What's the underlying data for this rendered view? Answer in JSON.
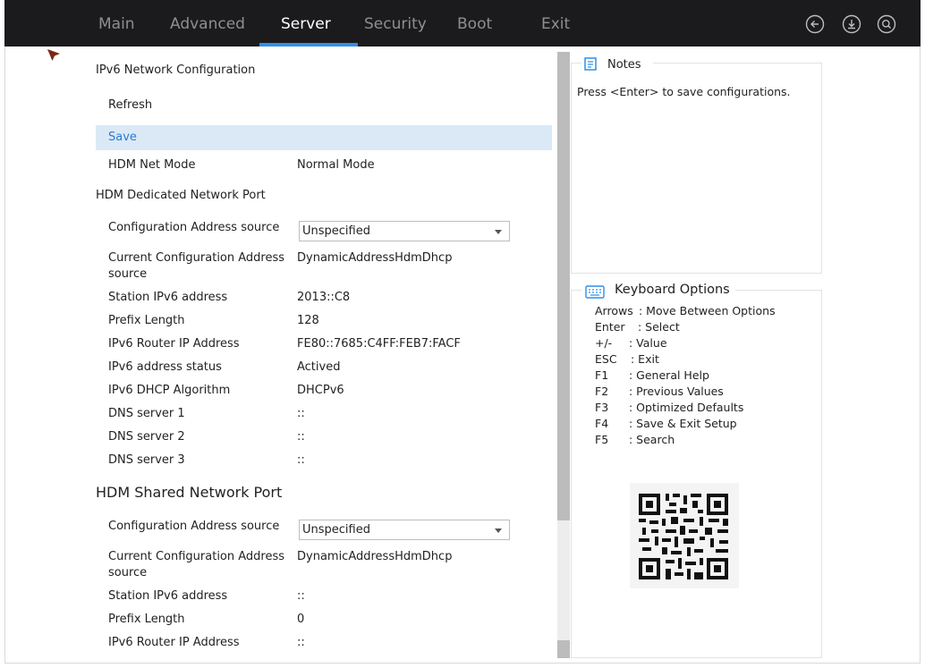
{
  "nav": {
    "tabs": [
      "Main",
      "Advanced",
      "Server",
      "Security",
      "Boot",
      "Exit"
    ],
    "active_tab": "Server",
    "buttons": [
      "back-icon",
      "download-icon",
      "search-icon"
    ]
  },
  "colors": {
    "nav_bg": "#1b1b1e",
    "accent": "#2f8ee8",
    "highlight": "#dbe9f6"
  },
  "ipv6": {
    "title": "IPv6 Network Configuration",
    "refresh": "Refresh",
    "save": "Save",
    "net_mode_label": "HDM Net Mode",
    "net_mode_value": "Normal Mode"
  },
  "dedicated": {
    "title": "HDM Dedicated Network Port",
    "rows": [
      {
        "label": "Configuration Address source",
        "value": "Unspecified"
      },
      {
        "label": "Current Configuration Address source",
        "value": "DynamicAddressHdmDhcp"
      },
      {
        "label": "Station IPv6 address",
        "value": "2013::C8"
      },
      {
        "label": "Prefix Length",
        "value": "128"
      },
      {
        "label": "IPv6 Router IP Address",
        "value": "FE80::7685:C4FF:FEB7:FACF"
      },
      {
        "label": "IPv6 address status",
        "value": "Actived"
      },
      {
        "label": "IPv6 DHCP Algorithm",
        "value": "DHCPv6"
      },
      {
        "label": "DNS server 1",
        "value": "::"
      },
      {
        "label": "DNS server 2",
        "value": "::"
      },
      {
        "label": "DNS server 3",
        "value": "::"
      }
    ]
  },
  "shared": {
    "title": "HDM Shared Network Port",
    "rows": [
      {
        "label": "Configuration Address source",
        "value": "Unspecified"
      },
      {
        "label": "Current Configuration Address source",
        "value": "DynamicAddressHdmDhcp"
      },
      {
        "label": "Station IPv6 address",
        "value": "::"
      },
      {
        "label": "Prefix Length",
        "value": "0"
      },
      {
        "label": "IPv6 Router IP Address",
        "value": "::"
      }
    ]
  },
  "notes": {
    "title": "Notes",
    "text": "Press <Enter> to save configurations."
  },
  "keyboard": {
    "title": "Keyboard Options",
    "rows": [
      {
        "key": "Arrows",
        "desc": ": Move Between Options"
      },
      {
        "key": "Enter",
        "desc": ": Select"
      },
      {
        "key": "+/-",
        "desc": ": Value"
      },
      {
        "key": "ESC",
        "desc": ": Exit"
      },
      {
        "key": "F1",
        "desc": ": General Help"
      },
      {
        "key": "F2",
        "desc": ": Previous Values"
      },
      {
        "key": "F3",
        "desc": ": Optimized Defaults"
      },
      {
        "key": "F4",
        "desc": ": Save & Exit Setup"
      },
      {
        "key": "F5",
        "desc": ": Search"
      }
    ]
  }
}
